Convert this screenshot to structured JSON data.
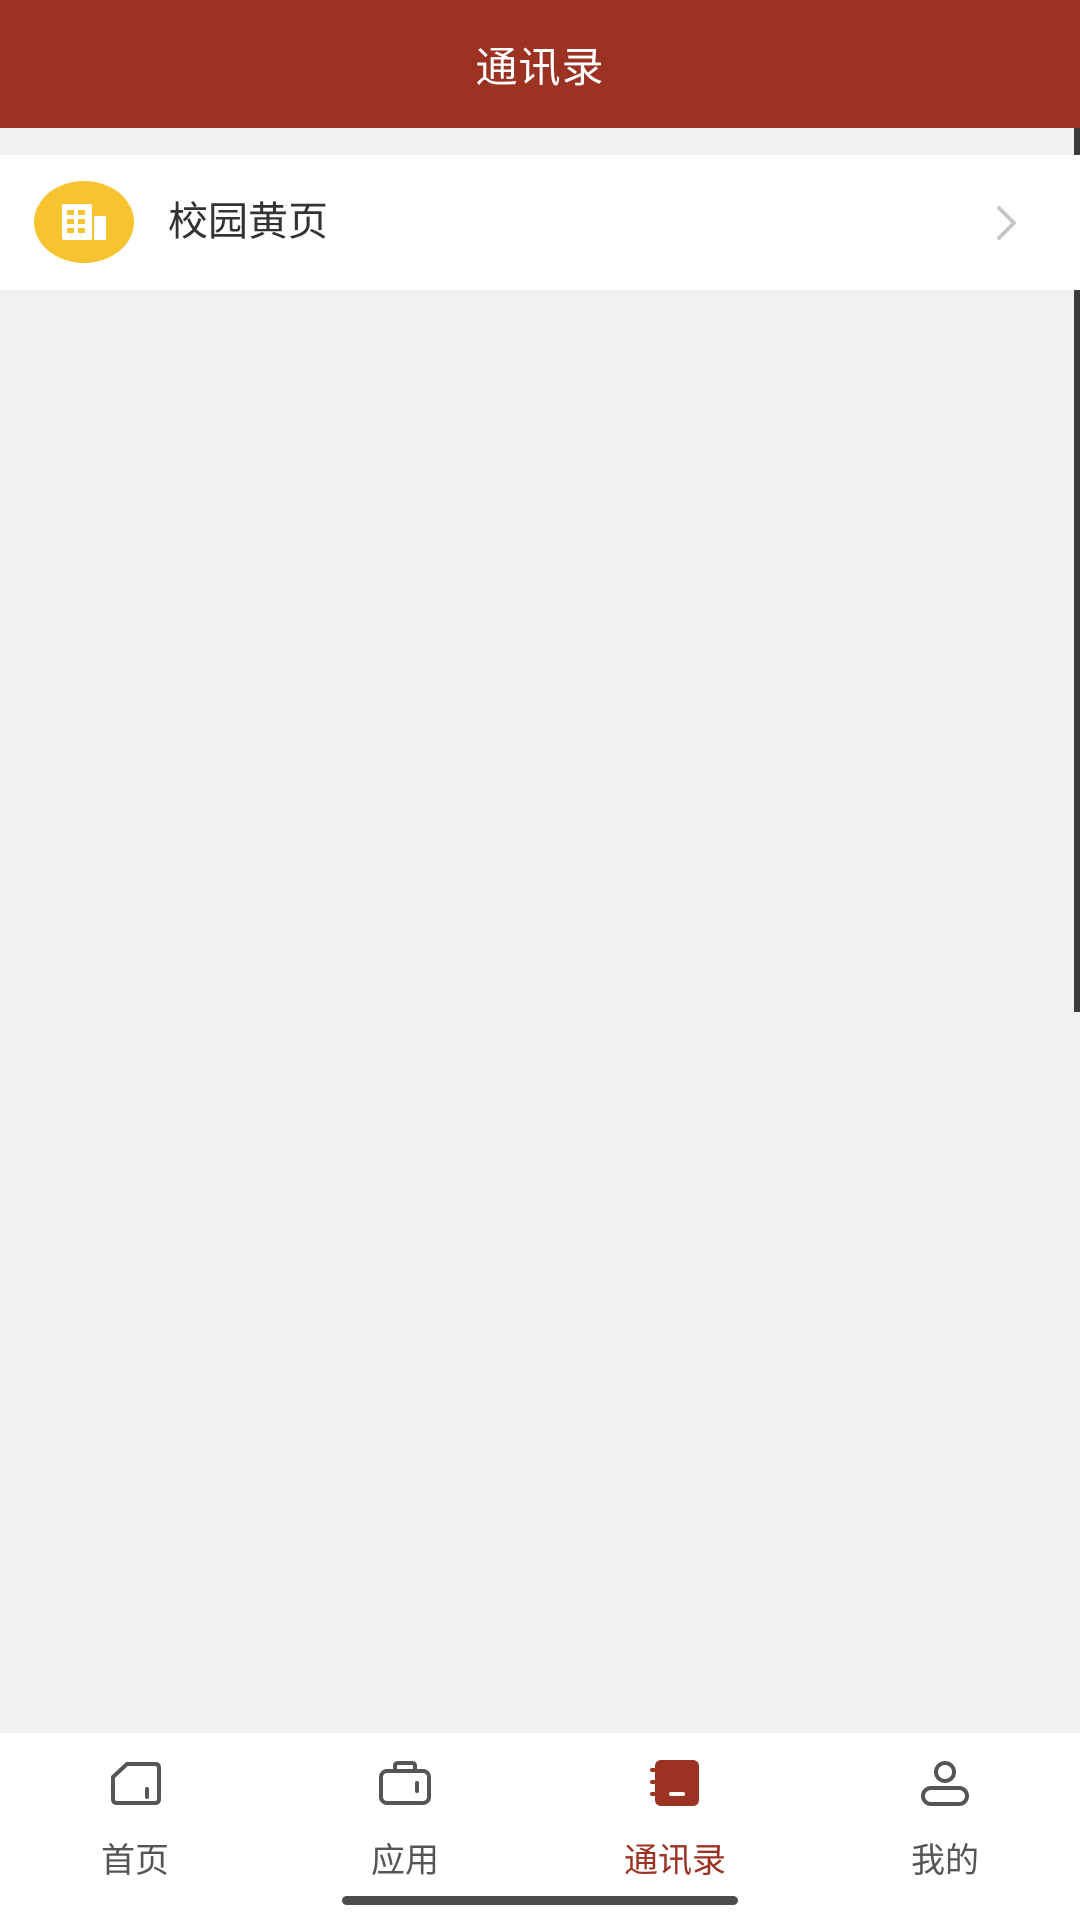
{
  "header": {
    "title": "通讯录"
  },
  "directory": {
    "items": [
      {
        "label": "校园黄页",
        "icon": "building-icon"
      }
    ]
  },
  "tabbar": {
    "tabs": [
      {
        "label": "首页",
        "icon": "home-icon",
        "active": false
      },
      {
        "label": "应用",
        "icon": "briefcase-icon",
        "active": false
      },
      {
        "label": "通讯录",
        "icon": "contacts-book-icon",
        "active": true
      },
      {
        "label": "我的",
        "icon": "user-icon",
        "active": false
      }
    ]
  },
  "colors": {
    "primary": "#9c3222",
    "background": "#f1f1f1",
    "icon_yellow": "#f7c331",
    "text": "#333333",
    "inactive_tab": "#555555"
  }
}
